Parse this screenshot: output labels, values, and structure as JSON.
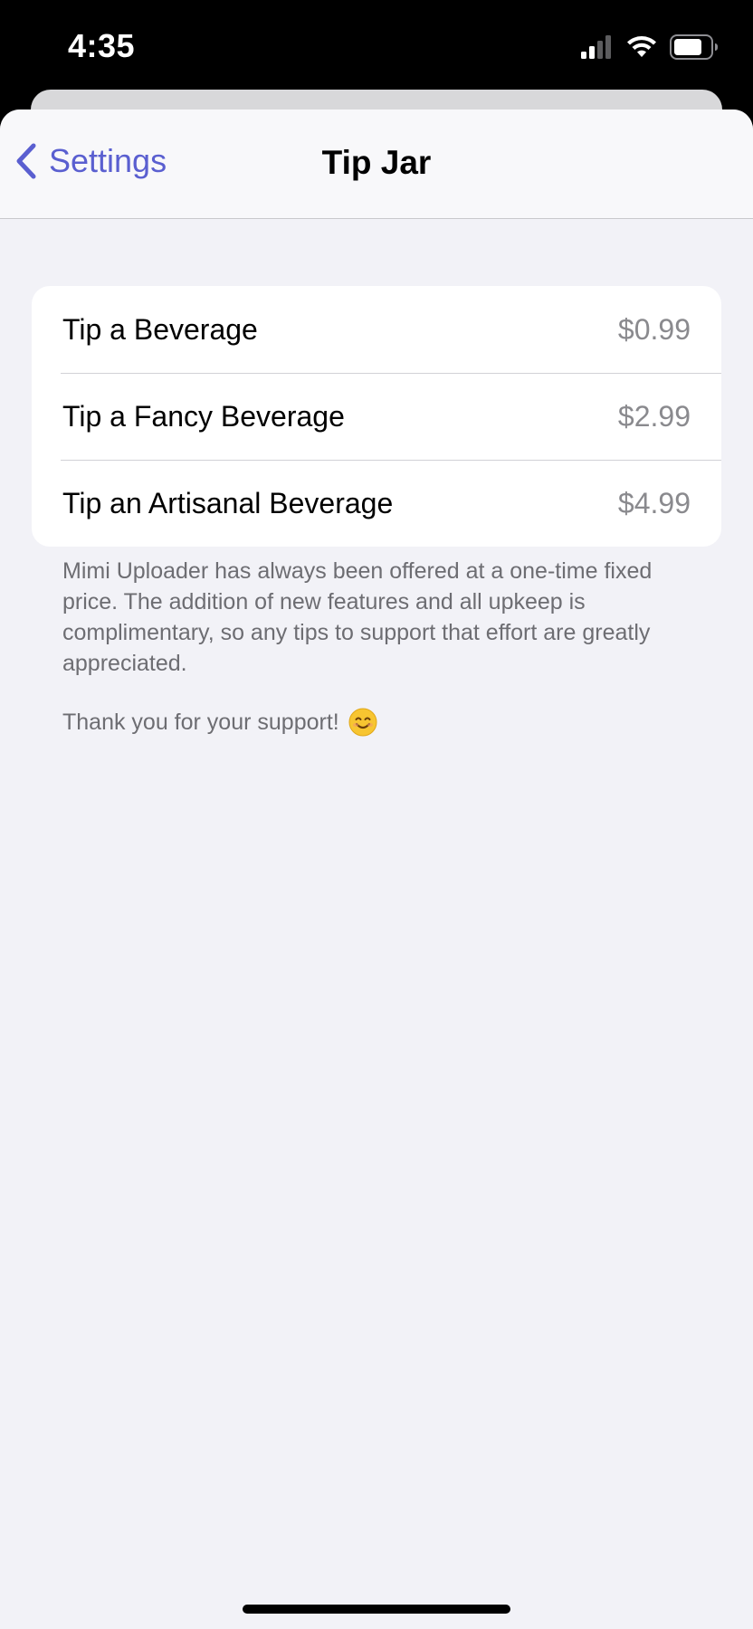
{
  "status_bar": {
    "time": "4:35",
    "icons": [
      "cellular-signal-icon",
      "wifi-icon",
      "battery-icon"
    ]
  },
  "nav": {
    "back_label": "Settings",
    "title": "Tip Jar"
  },
  "tips": [
    {
      "label": "Tip a Beverage",
      "price": "$0.99"
    },
    {
      "label": "Tip a Fancy Beverage",
      "price": "$2.99"
    },
    {
      "label": "Tip an Artisanal Beverage",
      "price": "$4.99"
    }
  ],
  "footer": {
    "description": "Mimi Uploader has always been offered at a one-time fixed price. The addition of new features and all upkeep is complimentary, so any tips to support that effort are greatly appreciated.",
    "thanks": "Thank you for your support!",
    "thanks_icon": "smiling-face-icon"
  },
  "colors": {
    "accent": "#5a5fd0",
    "background": "#f2f2f7",
    "secondary_text": "#8a8a8e"
  }
}
